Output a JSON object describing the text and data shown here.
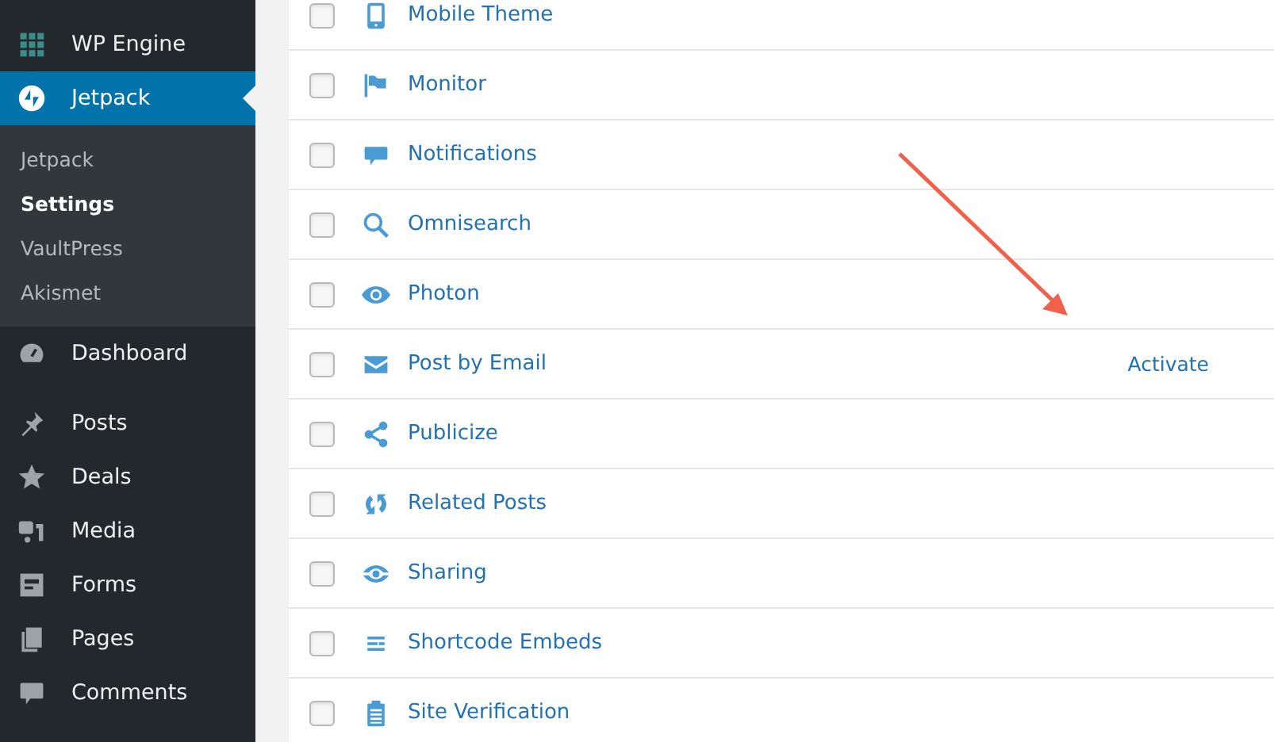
{
  "sidebar": {
    "items": [
      {
        "label": "WP Engine",
        "selected": false
      },
      {
        "label": "Jetpack",
        "selected": true,
        "children": [
          {
            "label": "Jetpack",
            "selected": false
          },
          {
            "label": "Settings",
            "selected": true
          },
          {
            "label": "VaultPress",
            "selected": false
          },
          {
            "label": "Akismet",
            "selected": false
          }
        ]
      },
      {
        "label": "Dashboard",
        "selected": false
      },
      {
        "label": "Posts",
        "selected": false
      },
      {
        "label": "Deals",
        "selected": false
      },
      {
        "label": "Media",
        "selected": false
      },
      {
        "label": "Forms",
        "selected": false
      },
      {
        "label": "Pages",
        "selected": false
      },
      {
        "label": "Comments",
        "selected": false
      }
    ]
  },
  "modules": [
    {
      "name": "Mobile Theme",
      "checked": false
    },
    {
      "name": "Monitor",
      "checked": false
    },
    {
      "name": "Notifications",
      "checked": false
    },
    {
      "name": "Omnisearch",
      "checked": false
    },
    {
      "name": "Photon",
      "checked": false
    },
    {
      "name": "Post by Email",
      "checked": false,
      "action": "Activate"
    },
    {
      "name": "Publicize",
      "checked": false
    },
    {
      "name": "Related Posts",
      "checked": false
    },
    {
      "name": "Sharing",
      "checked": false
    },
    {
      "name": "Shortcode Embeds",
      "checked": false
    },
    {
      "name": "Site Verification",
      "checked": false
    }
  ],
  "annotation": {
    "kind": "arrow"
  }
}
